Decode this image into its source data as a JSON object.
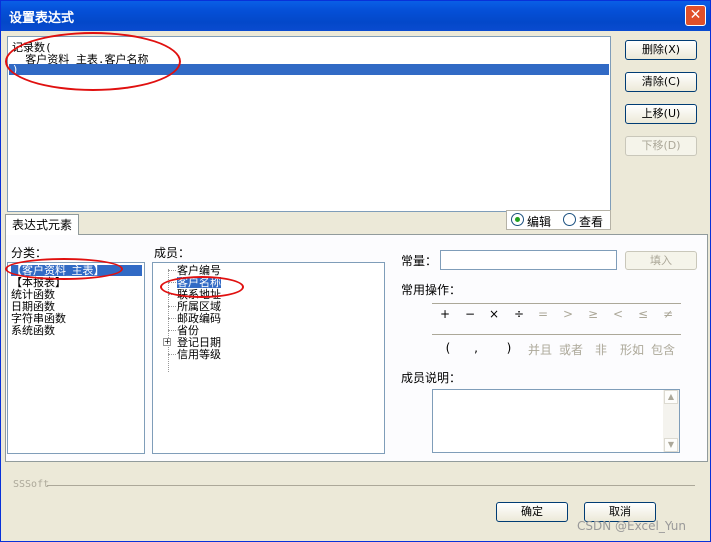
{
  "window": {
    "title": "设置表达式",
    "close_symbol": "✕"
  },
  "expression": {
    "lines": [
      "记录数(",
      "  客户资料_主表.客户名称",
      ")"
    ]
  },
  "side_buttons": {
    "delete": "删除(X)",
    "clear": "清除(C)",
    "move_up": "上移(U)",
    "move_down": "下移(D)"
  },
  "tab": {
    "label": "表达式元素"
  },
  "mode": {
    "edit": "编辑",
    "view": "查看",
    "selected": "编辑"
  },
  "category": {
    "label": "分类：",
    "items": [
      "【客户资料_主表】",
      "【本报表】",
      "统计函数",
      "日期函数",
      "字符串函数",
      "系统函数"
    ]
  },
  "members": {
    "label": "成员：",
    "items": [
      "客户编号",
      "客户名称",
      "联系地址",
      "所属区域",
      "邮政编码",
      "省份",
      "登记日期",
      "信用等级"
    ]
  },
  "constant": {
    "label": "常量：",
    "fill_button": "填入"
  },
  "operations": {
    "label": "常用操作：",
    "symbols": [
      "+",
      "−",
      "×",
      "÷",
      "=",
      ">",
      "≥",
      "<",
      "≤",
      "≠"
    ],
    "row2": [
      "(",
      ",",
      ")",
      "并且",
      "或者",
      "非",
      "形如",
      "包含"
    ]
  },
  "member_desc": {
    "label": "成员说明："
  },
  "footer": {
    "brand": "SSSoft",
    "ok": "确定",
    "cancel": "取消"
  },
  "watermark": "CSDN @Excel_Yun"
}
